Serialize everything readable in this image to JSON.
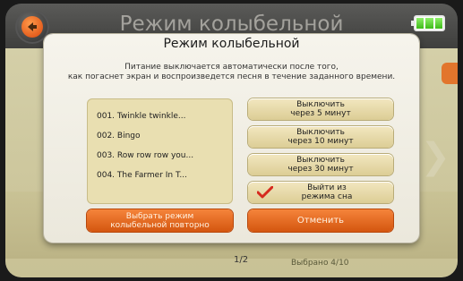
{
  "background": {
    "title": "Режим колыбельной",
    "page_indicator": "1/2",
    "selected_count": "Выбрано 4/10",
    "battery_cells": 3
  },
  "dialog": {
    "title": "Режим колыбельной",
    "description_line1": "Питание выключается автоматически после того,",
    "description_line2": "как погаснет экран и воспроизведется песня в течение заданного времени.",
    "songs": [
      "001. Twinkle twinkle...",
      "002. Bingo",
      "003. Row row row you...",
      "004. The Farmer In T..."
    ],
    "buttons": {
      "off_5_line1": "Выключить",
      "off_5_line2": "через 5 минут",
      "off_10_line1": "Выключить",
      "off_10_line2": "через 10 минут",
      "off_30_line1": "Выключить",
      "off_30_line2": "через 30 минут",
      "exit_sleep_line1": "Выйти из",
      "exit_sleep_line2": "режима сна",
      "reselect_line1": "Выбрать режим",
      "reselect_line2": "колыбельной повторно",
      "cancel": "Отменить"
    },
    "selected_option": "exit_sleep"
  },
  "colors": {
    "accent_orange": "#e2752c",
    "panel_tan": "#e9dfb1",
    "check_red": "#d62a1e"
  }
}
